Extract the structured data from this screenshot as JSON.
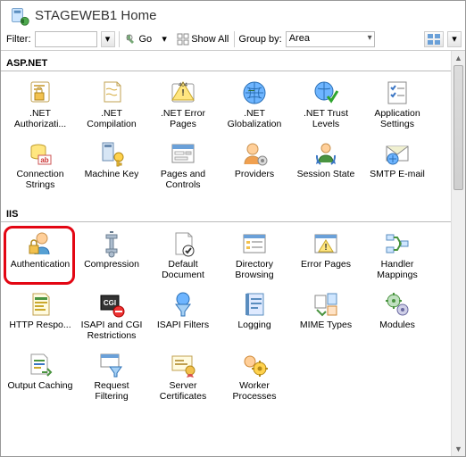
{
  "title": "STAGEWEB1 Home",
  "toolbar": {
    "filter_label": "Filter:",
    "go_label": "Go",
    "show_all_label": "Show All",
    "group_by_label": "Group by:",
    "group_by_value": "Area"
  },
  "sections": {
    "aspnet": {
      "header": "ASP.NET",
      "items": [
        ".NET Authorizati...",
        ".NET Compilation",
        ".NET Error Pages",
        ".NET Globalization",
        ".NET Trust Levels",
        "Application Settings",
        "Connection Strings",
        "Machine Key",
        "Pages and Controls",
        "Providers",
        "Session State",
        "SMTP E-mail"
      ]
    },
    "iis": {
      "header": "IIS",
      "items": [
        "Authentication",
        "Compression",
        "Default Document",
        "Directory Browsing",
        "Error Pages",
        "Handler Mappings",
        "HTTP Respo...",
        "ISAPI and CGI Restrictions",
        "ISAPI Filters",
        "Logging",
        "MIME Types",
        "Modules",
        "Output Caching",
        "Request Filtering",
        "Server Certificates",
        "Worker Processes"
      ]
    }
  }
}
